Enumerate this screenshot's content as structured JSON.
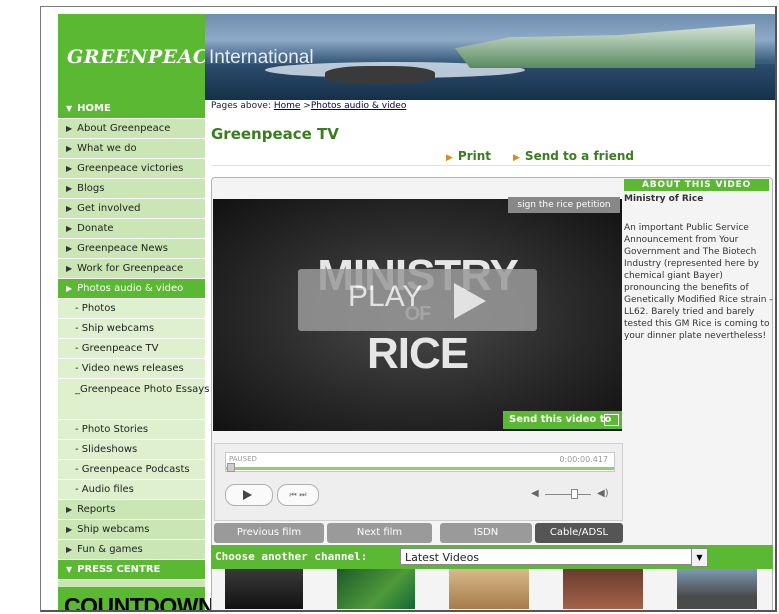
{
  "header": {
    "logo": "GREENPEACE",
    "banner_text": "International"
  },
  "sidebar": {
    "items": [
      {
        "label": "HOME",
        "kind": "header"
      },
      {
        "label": "About Greenpeace",
        "kind": "item"
      },
      {
        "label": "What we do",
        "kind": "item"
      },
      {
        "label": "Greenpeace victories",
        "kind": "item"
      },
      {
        "label": "Blogs",
        "kind": "item"
      },
      {
        "label": "Get involved",
        "kind": "item"
      },
      {
        "label": "Donate",
        "kind": "item"
      },
      {
        "label": "Greenpeace News",
        "kind": "item"
      },
      {
        "label": "Work for Greenpeace",
        "kind": "item"
      },
      {
        "label": "Photos audio & video",
        "kind": "active"
      },
      {
        "label": "Photos",
        "kind": "sub"
      },
      {
        "label": "Ship webcams",
        "kind": "sub"
      },
      {
        "label": "Greenpeace TV",
        "kind": "sub"
      },
      {
        "label": "Video news releases",
        "kind": "sub"
      },
      {
        "label": "Greenpeace Photo Essays",
        "kind": "sub2"
      },
      {
        "label": "Photo Stories",
        "kind": "sub"
      },
      {
        "label": "Slideshows",
        "kind": "sub"
      },
      {
        "label": "Greenpeace Podcasts",
        "kind": "sub"
      },
      {
        "label": "Audio files",
        "kind": "sub"
      },
      {
        "label": "Reports",
        "kind": "item"
      },
      {
        "label": "Ship webcams",
        "kind": "item"
      },
      {
        "label": "Fun & games",
        "kind": "item"
      },
      {
        "label": "PRESS CENTRE",
        "kind": "header"
      }
    ],
    "countdown": "COUNTDOWN"
  },
  "breadcrumb": {
    "prefix": "Pages above:",
    "home": "Home",
    "sep": ">",
    "section": "Photos audio & video"
  },
  "page_title": "Greenpeace TV",
  "actions": {
    "print": "Print",
    "send": "Send to a friend"
  },
  "video": {
    "title_line1": "MINISTRY",
    "title_line2": "OF",
    "title_line3": "RICE",
    "play_label": "PLAY",
    "petition_link": "sign the rice petition",
    "send_video": "Send this video to"
  },
  "about": {
    "heading": "ABOUT THIS VIDEO",
    "subtitle": "Ministry of Rice",
    "text": "An important Public Service Announcement from Your Government and The Biotech Industry (represented here by chemical giant Bayer) pronouncing the benefits of Genetically Modified Rice strain - LL62. Barely tried and barely tested this GM Rice is coming to your dinner plate nevertheless!"
  },
  "player": {
    "status": "PAUSED",
    "time": "0:00:00.417",
    "progress_fraction": 0.0
  },
  "buttons": {
    "previous": "Previous film",
    "next": "Next film",
    "isdn": "ISDN",
    "cable": "Cable/ADSL"
  },
  "channel": {
    "label": "Choose another channel:",
    "selected": "Latest Videos"
  },
  "colors": {
    "brand_green": "#5bb833",
    "sidebar_bg": "#c9e6b4",
    "title_green": "#3a7d1e",
    "accent_orange": "#e08a1e"
  }
}
